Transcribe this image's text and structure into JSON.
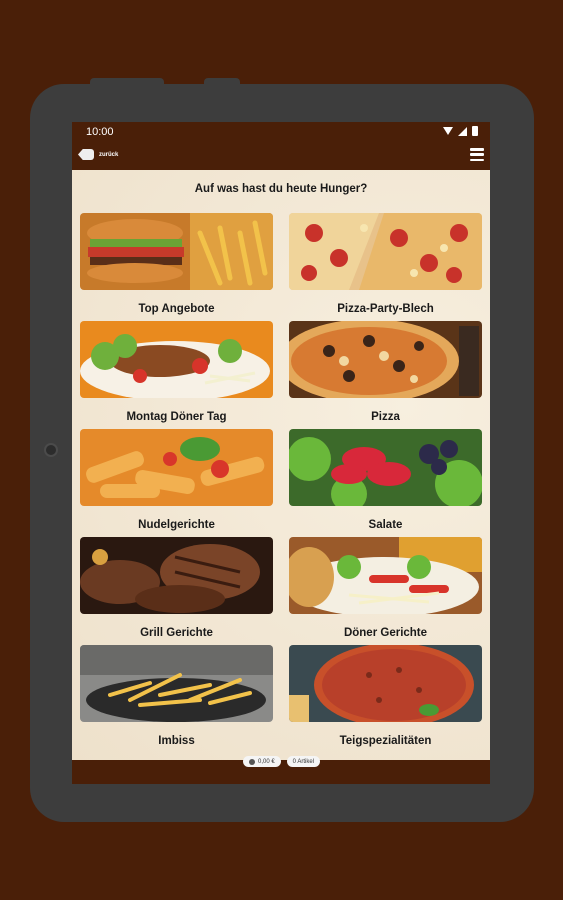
{
  "status_bar": {
    "time": "10:00"
  },
  "app_bar": {
    "back_label": "zurück"
  },
  "headline": "Auf was hast du heute Hunger?",
  "categories": [
    {
      "label": "Top Angebote",
      "icon": "burger-fries-image"
    },
    {
      "label": "Pizza-Party-Blech",
      "icon": "pizza-slices-image"
    },
    {
      "label": "Montag Döner Tag",
      "icon": "doner-plate-image"
    },
    {
      "label": "Pizza",
      "icon": "pizza-image"
    },
    {
      "label": "Nudelgerichte",
      "icon": "pasta-image"
    },
    {
      "label": "Salate",
      "icon": "salad-image"
    },
    {
      "label": "Grill Gerichte",
      "icon": "grilled-meat-image"
    },
    {
      "label": "Döner Gerichte",
      "icon": "doner-image"
    },
    {
      "label": "Imbiss",
      "icon": "fries-image"
    },
    {
      "label": "Teigspezialitäten",
      "icon": "lahmacun-image"
    }
  ],
  "cart": {
    "total": "0,00 €",
    "items": "0 Artikel"
  },
  "colors": {
    "frame_brown": "#4a1f08",
    "tablet_gray": "#3d3d3d",
    "content_bg": "#f2e7d4"
  }
}
